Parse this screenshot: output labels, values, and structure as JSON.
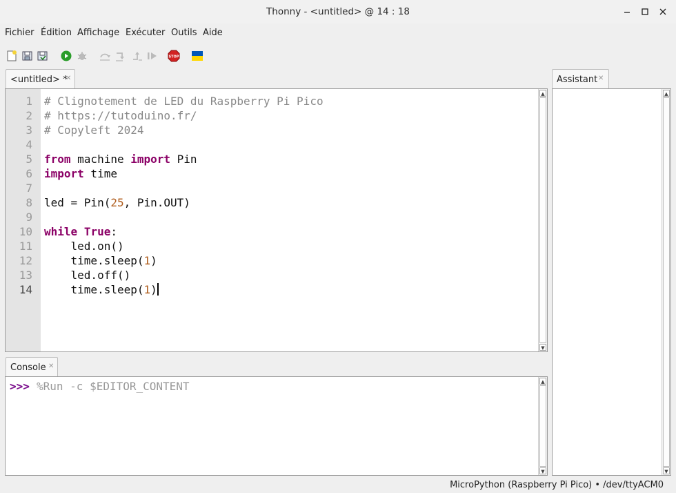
{
  "window": {
    "title": "Thonny - <untitled> @ 14 : 18"
  },
  "menu": [
    "Fichier",
    "Édition",
    "Affichage",
    "Exécuter",
    "Outils",
    "Aide"
  ],
  "toolbar": {
    "icons": [
      "new-file-icon",
      "open-file-icon",
      "save-file-icon",
      "run-icon",
      "debug-icon",
      "step-over-icon",
      "step-into-icon",
      "step-out-icon",
      "resume-icon",
      "stop-icon",
      "ukraine-flag-icon"
    ],
    "colors": {
      "run": "#2a9d2a",
      "stop": "#d22222",
      "flag_blue": "#0057b7",
      "flag_yellow": "#ffd700"
    }
  },
  "editor": {
    "tab_label": "<untitled> *",
    "line_numbers": [
      "1",
      "2",
      "3",
      "4",
      "5",
      "6",
      "7",
      "8",
      "9",
      "10",
      "11",
      "12",
      "13",
      "14"
    ],
    "lines": {
      "l1": "# Clignotement de LED du Raspberry Pi Pico",
      "l2": "# https://tutoduino.fr/",
      "l3": "# Copyleft 2024",
      "l5_kw1": "from",
      "l5_mid": " machine ",
      "l5_kw2": "import",
      "l5_end": " Pin",
      "l6_kw": "import",
      "l6_end": " time",
      "l8_a": "led = Pin(",
      "l8_num": "25",
      "l8_b": ", Pin.OUT)",
      "l10_kw1": "while",
      "l10_sp": " ",
      "l10_kw2": "True",
      "l10_end": ":",
      "l11": "    led.on()",
      "l12_a": "    time.sleep(",
      "l12_num": "1",
      "l12_b": ")",
      "l13": "    led.off()",
      "l14_a": "    time.sleep(",
      "l14_num": "1",
      "l14_b": ")"
    }
  },
  "assistant": {
    "tab_label": "Assistant"
  },
  "console": {
    "tab_label": "Console",
    "prompt": ">>>",
    "command": "%Run -c $EDITOR_CONTENT"
  },
  "status": {
    "interpreter": "MicroPython (Raspberry Pi Pico)  •  /dev/ttyACM0"
  }
}
